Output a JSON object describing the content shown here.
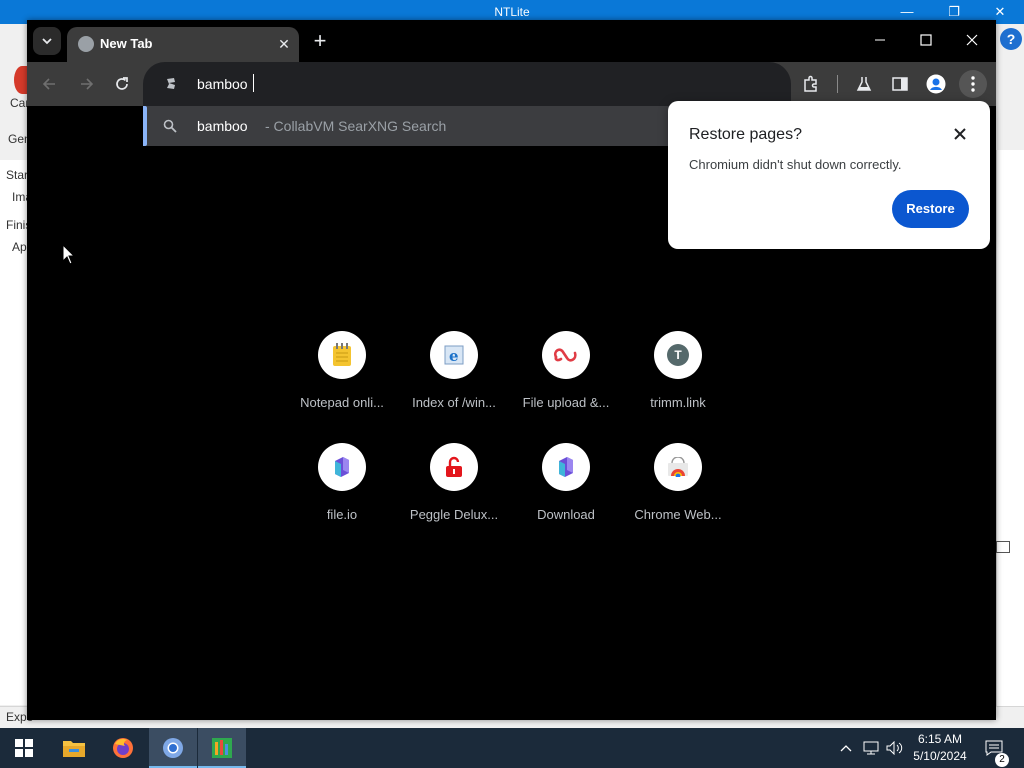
{
  "background_app": {
    "title": "NTLite",
    "controls": [
      "—",
      "❐",
      "✕"
    ],
    "help": "?",
    "fragments": {
      "car": "Car",
      "gen": "Gen",
      "star": "Star",
      "ima": "Ima",
      "finis": "Finis",
      "ap": "Ap",
      "expo": "Expo"
    }
  },
  "browser": {
    "tab": {
      "title": "New Tab"
    },
    "omnibox": {
      "value": "bamboo"
    },
    "suggestion": {
      "query": "bamboo",
      "description": "- CollabVM SearXNG Search"
    },
    "restore_popup": {
      "title": "Restore pages?",
      "message": "Chromium didn't shut down correctly.",
      "button": "Restore"
    },
    "shortcuts": [
      {
        "label": "Notepad onli...",
        "icon": "notepad-icon"
      },
      {
        "label": "Index of /win...",
        "icon": "ie-icon"
      },
      {
        "label": "File upload &...",
        "icon": "link-icon"
      },
      {
        "label": "trimm.link",
        "icon": "letter-t-icon",
        "letter": "T"
      },
      {
        "label": "file.io",
        "icon": "file-io-icon"
      },
      {
        "label": "Peggle Delux...",
        "icon": "lock-icon"
      },
      {
        "label": "Download",
        "icon": "file-io-icon"
      },
      {
        "label": "Chrome Web...",
        "icon": "chrome-store-icon"
      }
    ]
  },
  "taskbar": {
    "clock_time": "6:15 AM",
    "clock_date": "5/10/2024",
    "notifications": "2",
    "apps": [
      "start-button",
      "file-explorer",
      "firefox",
      "chromium",
      "ntlite"
    ]
  },
  "colors": {
    "win_blue": "#0a78d7",
    "chrome_toolbar": "#3c3c3c",
    "restore_button": "#0b57d0",
    "taskbar": "#1b2a3a"
  }
}
